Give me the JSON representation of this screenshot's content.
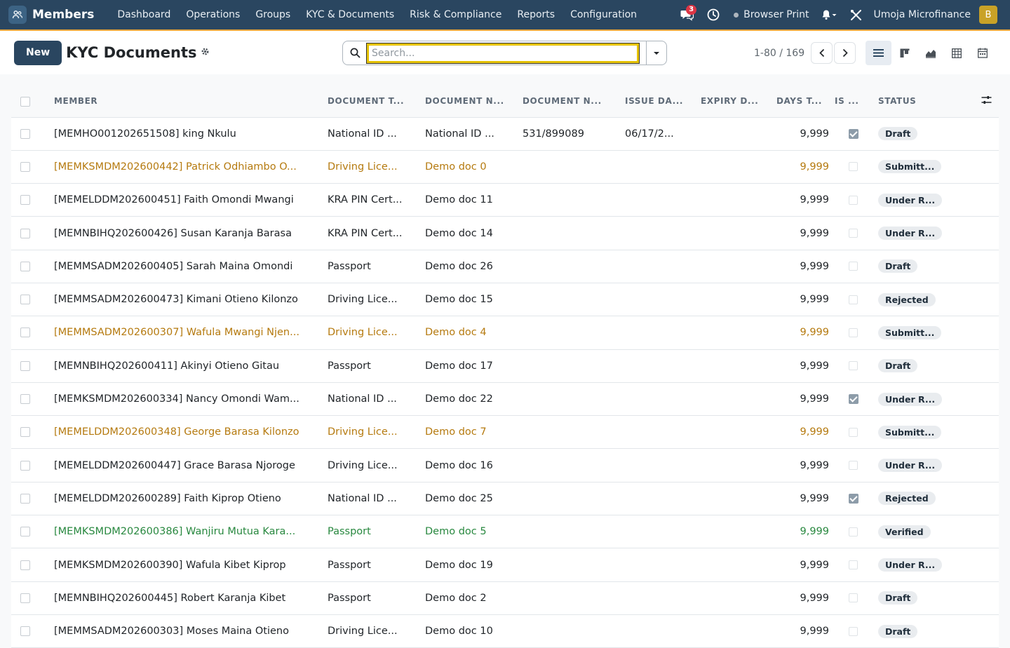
{
  "navbar": {
    "brand": "Members",
    "menu": [
      "Dashboard",
      "Operations",
      "Groups",
      "KYC & Documents",
      "Risk & Compliance",
      "Reports",
      "Configuration"
    ],
    "messages_count": "3",
    "browser_print": "Browser Print",
    "company": "Umoja Microfinance",
    "avatar_letter": "B",
    "icons": [
      "apps-icon",
      "chat-icon",
      "clock-icon",
      "bell-icon",
      "tools-icon"
    ]
  },
  "control": {
    "new_label": "New",
    "title": "KYC Documents",
    "search_placeholder": "Search...",
    "pager": "1-80 / 169"
  },
  "table": {
    "headers": [
      "MEMBER",
      "DOCUMENT T...",
      "DOCUMENT N...",
      "DOCUMENT N...",
      "ISSUE DA...",
      "EXPIRY D...",
      "DAYS T...",
      "IS ...",
      "STATUS"
    ],
    "rows": [
      {
        "member": "[MEMHO001202651508] king Nkulu",
        "doc_type": "National ID ...",
        "doc_name": "National ID ...",
        "doc_number": "531/899089",
        "issue": "06/17/2...",
        "expiry": "",
        "days": "9,999",
        "is": true,
        "status": "Draft",
        "tone": ""
      },
      {
        "member": "[MEMKSMDM202600442] Patrick Odhiambo O...",
        "doc_type": "Driving Lice...",
        "doc_name": "Demo doc 0",
        "doc_number": "",
        "issue": "",
        "expiry": "",
        "days": "9,999",
        "is": false,
        "status": "Submitt...",
        "tone": "warn"
      },
      {
        "member": "[MEMELDDM202600451] Faith Omondi Mwangi",
        "doc_type": "KRA PIN Cert...",
        "doc_name": "Demo doc 11",
        "doc_number": "",
        "issue": "",
        "expiry": "",
        "days": "9,999",
        "is": false,
        "status": "Under R...",
        "tone": ""
      },
      {
        "member": "[MEMNBIHQ202600426] Susan Karanja Barasa",
        "doc_type": "KRA PIN Cert...",
        "doc_name": "Demo doc 14",
        "doc_number": "",
        "issue": "",
        "expiry": "",
        "days": "9,999",
        "is": false,
        "status": "Under R...",
        "tone": ""
      },
      {
        "member": "[MEMMSADM202600405] Sarah Maina Omondi",
        "doc_type": "Passport",
        "doc_name": "Demo doc 26",
        "doc_number": "",
        "issue": "",
        "expiry": "",
        "days": "9,999",
        "is": false,
        "status": "Draft",
        "tone": ""
      },
      {
        "member": "[MEMMSADM202600473] Kimani Otieno Kilonzo",
        "doc_type": "Driving Lice...",
        "doc_name": "Demo doc 15",
        "doc_number": "",
        "issue": "",
        "expiry": "",
        "days": "9,999",
        "is": false,
        "status": "Rejected",
        "tone": ""
      },
      {
        "member": "[MEMMSADM202600307] Wafula Mwangi Njen...",
        "doc_type": "Driving Lice...",
        "doc_name": "Demo doc 4",
        "doc_number": "",
        "issue": "",
        "expiry": "",
        "days": "9,999",
        "is": false,
        "status": "Submitt...",
        "tone": "warn"
      },
      {
        "member": "[MEMNBIHQ202600411] Akinyi Otieno Gitau",
        "doc_type": "Passport",
        "doc_name": "Demo doc 17",
        "doc_number": "",
        "issue": "",
        "expiry": "",
        "days": "9,999",
        "is": false,
        "status": "Draft",
        "tone": ""
      },
      {
        "member": "[MEMKSMDM202600334] Nancy Omondi Wam...",
        "doc_type": "National ID ...",
        "doc_name": "Demo doc 22",
        "doc_number": "",
        "issue": "",
        "expiry": "",
        "days": "9,999",
        "is": true,
        "status": "Under R...",
        "tone": ""
      },
      {
        "member": "[MEMELDDM202600348] George Barasa Kilonzo",
        "doc_type": "Driving Lice...",
        "doc_name": "Demo doc 7",
        "doc_number": "",
        "issue": "",
        "expiry": "",
        "days": "9,999",
        "is": false,
        "status": "Submitt...",
        "tone": "warn"
      },
      {
        "member": "[MEMELDDM202600447] Grace Barasa Njoroge",
        "doc_type": "Driving Lice...",
        "doc_name": "Demo doc 16",
        "doc_number": "",
        "issue": "",
        "expiry": "",
        "days": "9,999",
        "is": false,
        "status": "Under R...",
        "tone": ""
      },
      {
        "member": "[MEMELDDM202600289] Faith Kiprop Otieno",
        "doc_type": "National ID ...",
        "doc_name": "Demo doc 25",
        "doc_number": "",
        "issue": "",
        "expiry": "",
        "days": "9,999",
        "is": true,
        "status": "Rejected",
        "tone": ""
      },
      {
        "member": "[MEMKSMDM202600386] Wanjiru Mutua Kara...",
        "doc_type": "Passport",
        "doc_name": "Demo doc 5",
        "doc_number": "",
        "issue": "",
        "expiry": "",
        "days": "9,999",
        "is": false,
        "status": "Verified",
        "tone": "ok"
      },
      {
        "member": "[MEMKSMDM202600390] Wafula Kibet Kiprop",
        "doc_type": "Passport",
        "doc_name": "Demo doc 19",
        "doc_number": "",
        "issue": "",
        "expiry": "",
        "days": "9,999",
        "is": false,
        "status": "Under R...",
        "tone": ""
      },
      {
        "member": "[MEMNBIHQ202600445] Robert Karanja Kibet",
        "doc_type": "Passport",
        "doc_name": "Demo doc 2",
        "doc_number": "",
        "issue": "",
        "expiry": "",
        "days": "9,999",
        "is": false,
        "status": "Draft",
        "tone": ""
      },
      {
        "member": "[MEMMSADM202600303] Moses Maina Otieno",
        "doc_type": "Driving Lice...",
        "doc_name": "Demo doc 10",
        "doc_number": "",
        "issue": "",
        "expiry": "",
        "days": "9,999",
        "is": false,
        "status": "Draft",
        "tone": ""
      }
    ]
  }
}
